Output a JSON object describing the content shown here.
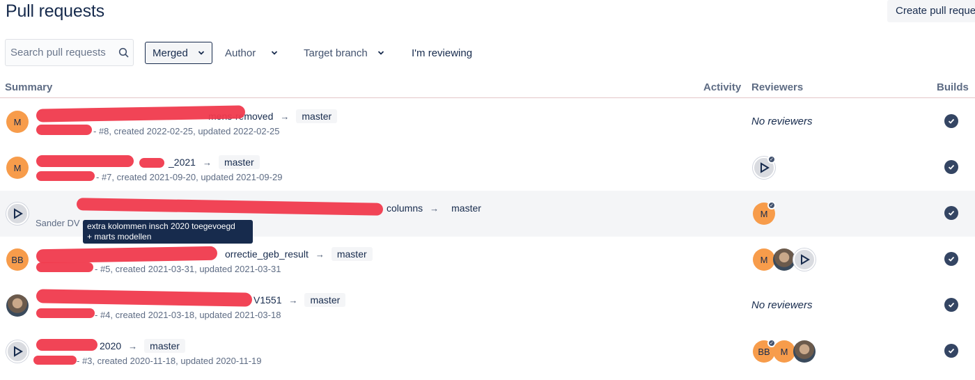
{
  "header": {
    "title": "Pull requests",
    "create_button": "Create pull reque"
  },
  "filters": {
    "search_placeholder": "Search pull requests",
    "status": "Merged",
    "author": "Author",
    "target_branch": "Target branch",
    "reviewing": "I'm reviewing"
  },
  "columns": {
    "summary": "Summary",
    "activity": "Activity",
    "reviewers": "Reviewers",
    "builds": "Builds"
  },
  "rows": [
    {
      "author_initial": "M",
      "source_branch": "mens-removed",
      "target_branch": "master",
      "meta": "- #8, created 2022-02-25, updated 2022-02-25",
      "reviewers_text": "No reviewers"
    },
    {
      "author_initial": "M",
      "source_branch": "_2021",
      "target_branch": "master",
      "meta": "- #7, created 2021-09-20, updated 2021-09-29",
      "reviewers_text": ""
    },
    {
      "author_initial": "",
      "source_branch": "columns",
      "target_branch": "master",
      "meta": "Sander DV -",
      "reviewers_text": ""
    },
    {
      "author_initial": "BB",
      "source_branch": "orrectie_geb_result",
      "target_branch": "master",
      "meta": "- #5, created 2021-03-31, updated 2021-03-31",
      "reviewers_text": ""
    },
    {
      "author_initial": "",
      "source_branch": "V1551",
      "target_branch": "master",
      "meta": "- #4, created 2021-03-18, updated 2021-03-18",
      "reviewers_text": "No reviewers"
    },
    {
      "author_initial": "",
      "source_branch": "2020",
      "target_branch": "master",
      "meta": "- #3, created 2020-11-18, updated 2020-11-19",
      "reviewers_text": ""
    }
  ],
  "reviewer_initials": {
    "m": "M",
    "bb": "BB"
  },
  "tooltip": {
    "line1": "extra kolommen insch 2020 toegevoegd",
    "line2": "+ marts modellen"
  },
  "colors": {
    "avatar_orange": "#f79c4b",
    "text": "#172b4d",
    "muted": "#5e6c84",
    "redaction": "#f03a4d"
  },
  "icons": {
    "search": "search-icon",
    "chevron": "chevron-down-icon",
    "arrow": "arrow-right-icon",
    "build": "build-success-icon"
  }
}
